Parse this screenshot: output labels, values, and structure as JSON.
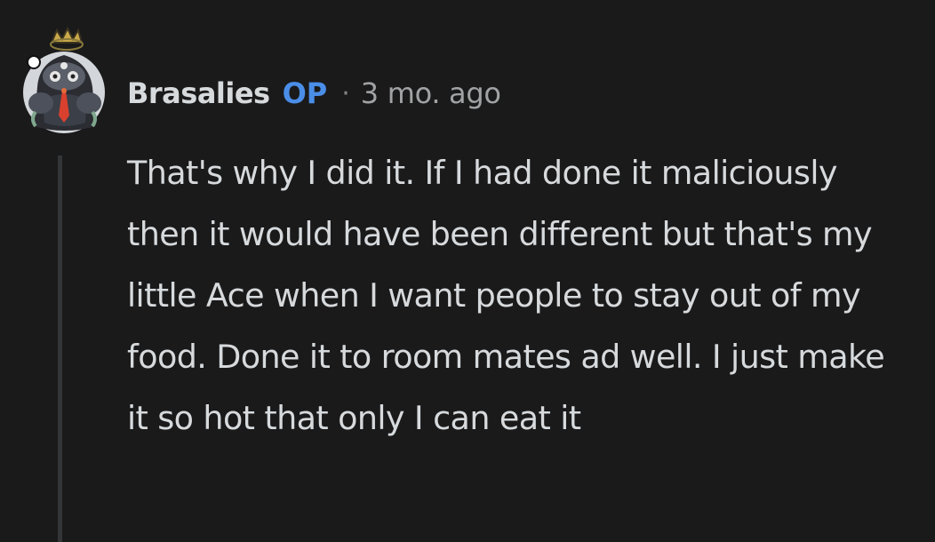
{
  "comment": {
    "author": "Brasalies",
    "badge": "OP",
    "separator": "·",
    "timestamp": "3 mo. ago",
    "text": "That's why I did it. If I had done it maliciously then it would have been different but that's my little Ace when I want people to stay out of my food. Done it to room mates ad well. I just make it so hot that only I can eat it",
    "avatar_icon": "snoo-avatar-icon"
  },
  "colors": {
    "background": "#1a1a1b",
    "text": "#d7dadc",
    "op_badge": "#4a8ee8",
    "meta": "#a0a2a3",
    "thread_line": "#343536"
  }
}
